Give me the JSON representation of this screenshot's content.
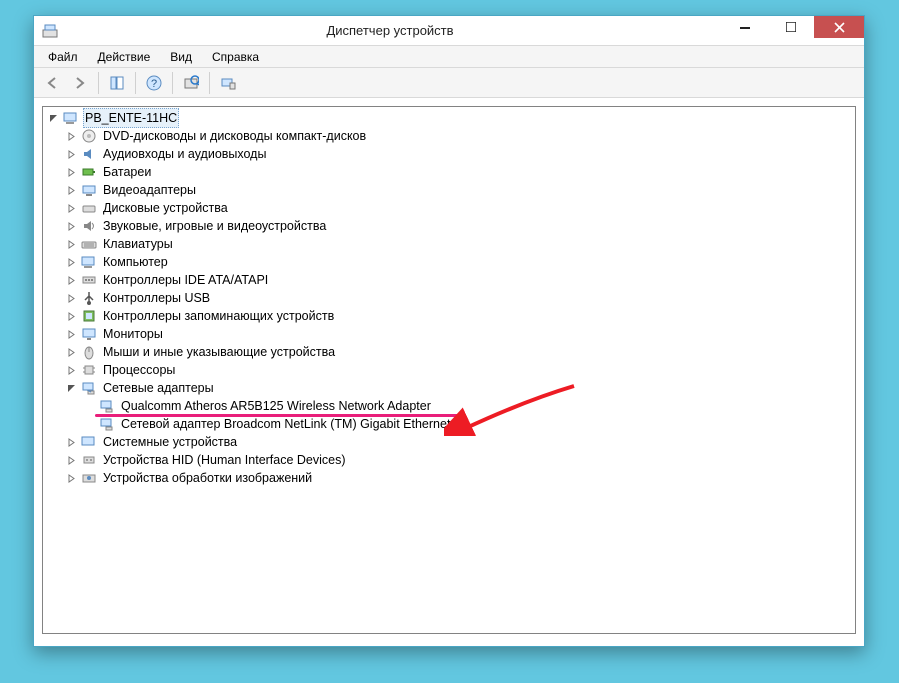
{
  "window": {
    "title": "Диспетчер устройств"
  },
  "menu": {
    "file": "Файл",
    "action": "Действие",
    "view": "Вид",
    "help": "Справка"
  },
  "tree": {
    "root": "PB_ENTE-11HC",
    "dvd": "DVD-дисководы и дисководы компакт-дисков",
    "audio": "Аудиовходы и аудиовыходы",
    "battery": "Батареи",
    "video": "Видеоадаптеры",
    "disk": "Дисковые устройства",
    "sound": "Звуковые, игровые и видеоустройства",
    "keyboard": "Клавиатуры",
    "computer": "Компьютер",
    "ide": "Контроллеры IDE ATA/ATAPI",
    "usb": "Контроллеры USB",
    "storage": "Контроллеры запоминающих устройств",
    "monitor": "Мониторы",
    "mouse": "Мыши и иные указывающие устройства",
    "cpu": "Процессоры",
    "network": "Сетевые адаптеры",
    "net1": "Qualcomm Atheros AR5B125 Wireless Network Adapter",
    "net2": "Сетевой адаптер Broadcom NetLink (TM) Gigabit Ethernet",
    "system": "Системные устройства",
    "hid": "Устройства HID (Human Interface Devices)",
    "imaging": "Устройства обработки изображений"
  }
}
